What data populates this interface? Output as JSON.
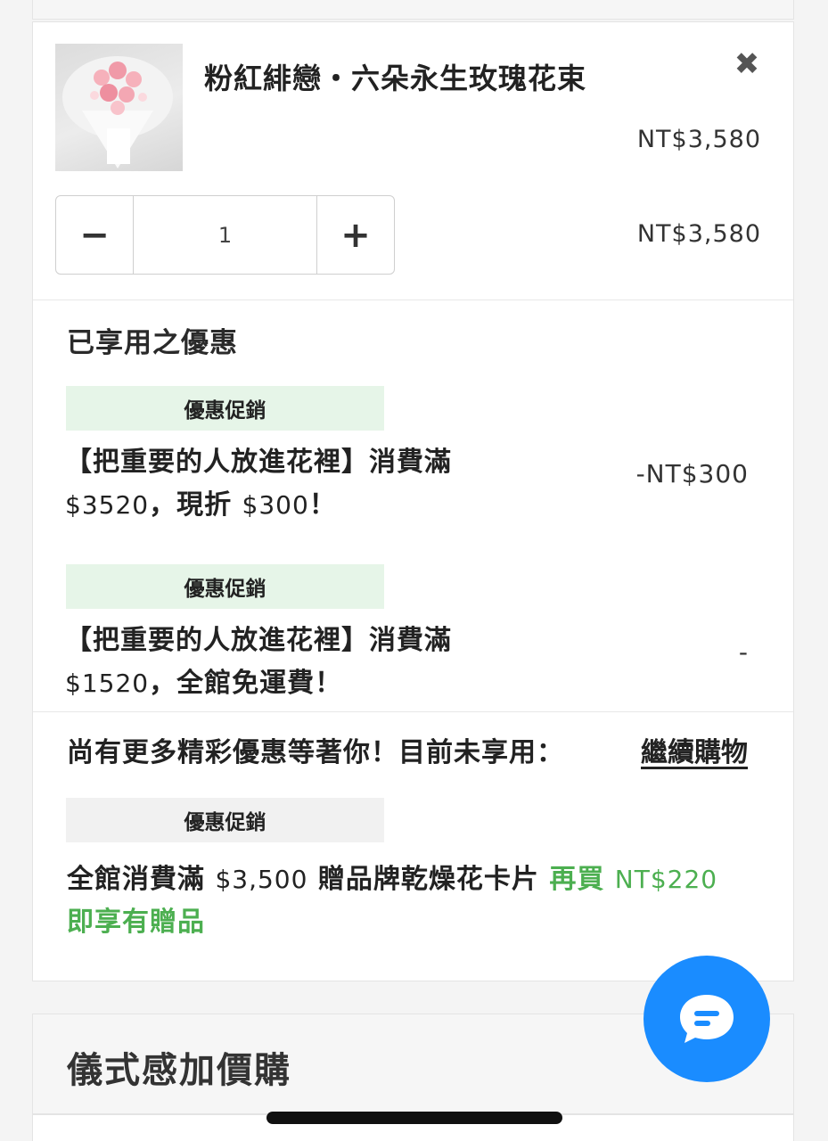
{
  "product": {
    "name": "粉紅緋戀・六朵永生玫瑰花束",
    "image_alt": "pink preserved rose bouquet",
    "unit_price": "NT$3,580",
    "quantity": "1",
    "subtotal": "NT$3,580",
    "remove_icon": "close-icon",
    "decrement_label": "−",
    "increment_label": "+"
  },
  "applied": {
    "title": "已享用之優惠",
    "promos": [
      {
        "tag": "優惠促銷",
        "line1": "【把重要的人放進花裡】消費滿",
        "amount": "$3520",
        "line2_rest": "，現折 ",
        "amount2": "$300",
        "line2_end": "！",
        "discount": "-NT$300"
      },
      {
        "tag": "優惠促銷",
        "line1": "【把重要的人放進花裡】消費滿",
        "amount": "$1520",
        "line2_rest": "，全館免運費！",
        "discount": "-"
      }
    ]
  },
  "unused": {
    "text": "尚有更多精彩優惠等著你！目前未享用：",
    "continue_link": "繼續購物",
    "promo_tag": "優惠促銷",
    "gift_prefix": "全館消費滿 ",
    "gift_threshold": "$3,500",
    "gift_middle": " 贈品牌乾燥花卡片 ",
    "gift_buy_more": "再買 ",
    "gift_remaining": "NT$220",
    "gift_suffix": "即享有贈品"
  },
  "addon": {
    "title": "儀式感加價購"
  },
  "colors": {
    "accent_green": "#4caf50",
    "tag_green_bg": "#e6f5e8",
    "tag_gray_bg": "#f1f1f1",
    "chat_blue": "#1a8cff"
  },
  "icons": {
    "chat": "chat-bubble-icon"
  }
}
